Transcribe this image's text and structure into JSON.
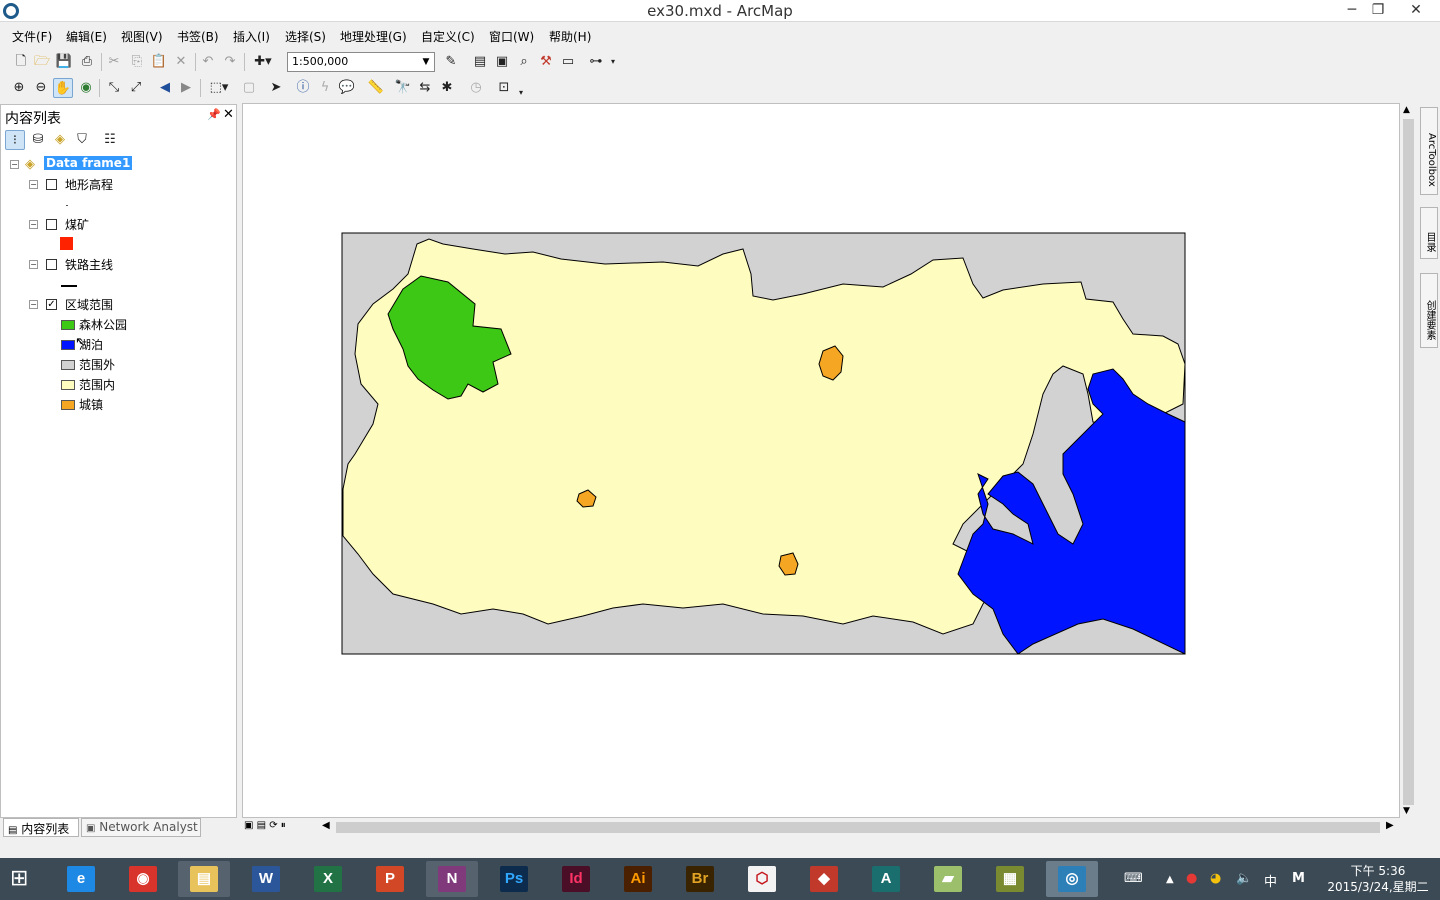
{
  "window": {
    "title": "ex30.mxd - ArcMap",
    "minimize": "─",
    "restore": "❐",
    "close": "✕"
  },
  "menu": [
    "文件(F)",
    "编辑(E)",
    "视图(V)",
    "书签(B)",
    "插入(I)",
    "选择(S)",
    "地理处理(G)",
    "自定义(C)",
    "窗口(W)",
    "帮助(H)"
  ],
  "toolbar": {
    "scale": "1:500,000"
  },
  "toc": {
    "title": "内容列表",
    "dataframe": "Data frame1",
    "layers": [
      {
        "name": "地形高程",
        "checked": false
      },
      {
        "name": "煤矿",
        "checked": false,
        "symbol_color": "#ff2200"
      },
      {
        "name": "铁路主线",
        "checked": false,
        "symbol_color": "#000000"
      },
      {
        "name": "区域范围",
        "checked": true
      }
    ],
    "legend": [
      {
        "label": "森林公园",
        "color": "#3cc814"
      },
      {
        "label": "湖泊",
        "color": "#0014ff"
      },
      {
        "label": "范围外",
        "color": "#d2d2d2"
      },
      {
        "label": "范围内",
        "color": "#fffcc0"
      },
      {
        "label": "城镇",
        "color": "#f5a623"
      }
    ],
    "tabs": [
      "内容列表",
      "Network Analyst"
    ]
  },
  "map_colors": {
    "outside": "#d2d2d2",
    "inside": "#fffcc0",
    "forest": "#3cc814",
    "lake": "#0014ff",
    "town": "#f5a623"
  },
  "dock": [
    "ArcToolbox",
    "目录",
    "创建要素"
  ],
  "clock": {
    "time": "下午 5:36",
    "date": "2015/3/24,星期二"
  },
  "tray": {
    "ime": "中",
    "m": "M"
  },
  "taskbar_apps": [
    {
      "name": "ie",
      "text": "e",
      "color": "#1e88e5"
    },
    {
      "name": "chrome",
      "text": "◉",
      "color": "#d9342b"
    },
    {
      "name": "explorer",
      "text": "▤",
      "color": "#e8c35c"
    },
    {
      "name": "word",
      "text": "W",
      "color": "#2b579a"
    },
    {
      "name": "excel",
      "text": "X",
      "color": "#217346"
    },
    {
      "name": "powerpoint",
      "text": "P",
      "color": "#d24726"
    },
    {
      "name": "onenote",
      "text": "N",
      "color": "#80397b"
    },
    {
      "name": "photoshop",
      "text": "Ps",
      "color": "#0d2b4d"
    },
    {
      "name": "indesign",
      "text": "Id",
      "color": "#4a0f26"
    },
    {
      "name": "illustrator",
      "text": "Ai",
      "color": "#4a2000"
    },
    {
      "name": "bridge",
      "text": "Br",
      "color": "#3a2400"
    },
    {
      "name": "acrobat",
      "text": "⬡",
      "color": "#c4161c"
    },
    {
      "name": "sketchup",
      "text": "◆",
      "color": "#c0392b"
    },
    {
      "name": "arccatalog",
      "text": "A",
      "color": "#1a6e6e"
    },
    {
      "name": "folder",
      "text": "▰",
      "color": "#9bbf6a"
    },
    {
      "name": "arcglobe",
      "text": "▦",
      "color": "#7a8a30"
    },
    {
      "name": "arcmap",
      "text": "◎",
      "color": "#2d7fb8"
    }
  ]
}
